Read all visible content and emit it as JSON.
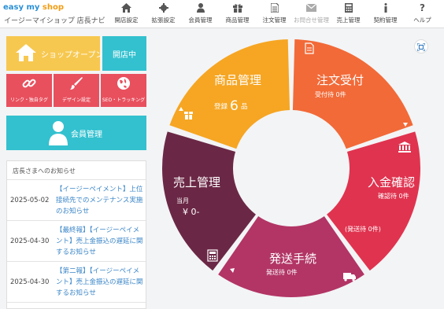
{
  "header": {
    "logo_text_a": "easy my ",
    "logo_text_b": "shop",
    "logo_sub": "イージーマイショップ 店長ナビ",
    "nav": [
      {
        "label": "開店設定",
        "icon": "home-icon"
      },
      {
        "label": "拡張設定",
        "icon": "gear-icon"
      },
      {
        "label": "会員管理",
        "icon": "person-icon"
      },
      {
        "label": "商品管理",
        "icon": "gift-icon"
      },
      {
        "label": "注文管理",
        "icon": "document-icon"
      },
      {
        "label": "お問合せ管理",
        "icon": "mail-icon"
      },
      {
        "label": "売上管理",
        "icon": "calculator-icon"
      },
      {
        "label": "契約管理",
        "icon": "info-icon"
      },
      {
        "label": "ヘルプ",
        "icon": "question-icon"
      }
    ]
  },
  "left": {
    "shop_open_label": "ショップオープン",
    "status_label": "開店中",
    "tiles": [
      {
        "label": "リンク・独自タグ",
        "icon": "link-icon"
      },
      {
        "label": "デザイン設定",
        "icon": "brush-icon"
      },
      {
        "label": "SEO・トラッキング",
        "icon": "globe-icon"
      }
    ],
    "member_label": "会員管理"
  },
  "news": {
    "title": "店長さまへのお知らせ",
    "items": [
      {
        "date": "2025-05-02",
        "text": "【イージーペイメント】上位接続先でのメンテナンス実施のお知らせ"
      },
      {
        "date": "2025-04-30",
        "text": "【最終報】【イージーペイメント】売上金振込の遅延に関するお知らせ"
      },
      {
        "date": "2025-04-30",
        "text": "【第二報】【イージーペイメント】売上金振込の遅延に関するお知らせ"
      }
    ]
  },
  "wheel": {
    "segments": [
      {
        "title": "商品管理",
        "sub_prefix": "登録",
        "value": "6",
        "sub_suffix": "品",
        "color": "#f6a623"
      },
      {
        "title": "注文受付",
        "sub": "受付待 0件",
        "color": "#f26a38"
      },
      {
        "title": "入金確認",
        "sub": "確認待 0件",
        "sub2": "(発送待 0件)",
        "color": "#e0334f"
      },
      {
        "title": "発送手続",
        "sub": "発送待 0件",
        "color": "#b23565"
      },
      {
        "title": "売上管理",
        "sub": "当月",
        "sub2": "¥ 0-",
        "color": "#6b2846"
      }
    ]
  }
}
